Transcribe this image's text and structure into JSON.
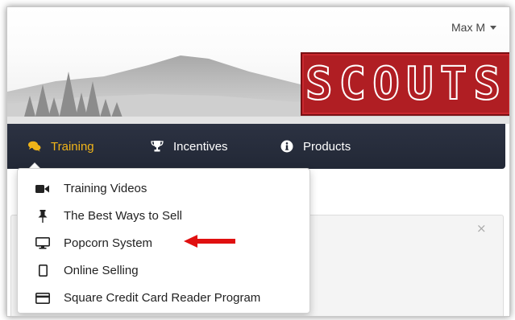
{
  "header": {
    "user_name": "Max M",
    "logo_text": "SCOUTS"
  },
  "navbar": {
    "items": [
      {
        "label": "Training",
        "icon": "comments-icon",
        "active": true
      },
      {
        "label": "Incentives",
        "icon": "trophy-icon",
        "active": false
      },
      {
        "label": "Products",
        "icon": "info-circle-icon",
        "active": false
      }
    ]
  },
  "dropdown": {
    "items": [
      {
        "label": "Training Videos",
        "icon": "video-camera-icon"
      },
      {
        "label": "The Best Ways to Sell",
        "icon": "pushpin-icon"
      },
      {
        "label": "Popcorn System",
        "icon": "desktop-monitor-icon",
        "highlighted_by_arrow": true
      },
      {
        "label": "Online Selling",
        "icon": "tablet-icon"
      },
      {
        "label": "Square Credit Card Reader Program",
        "icon": "credit-card-icon"
      }
    ]
  },
  "panel": {
    "close_glyph": "×"
  },
  "colors": {
    "navbar_bg": "#222836",
    "active_nav": "#f0b419",
    "logo_red": "#b01e23",
    "annotation_arrow": "#e01010"
  }
}
